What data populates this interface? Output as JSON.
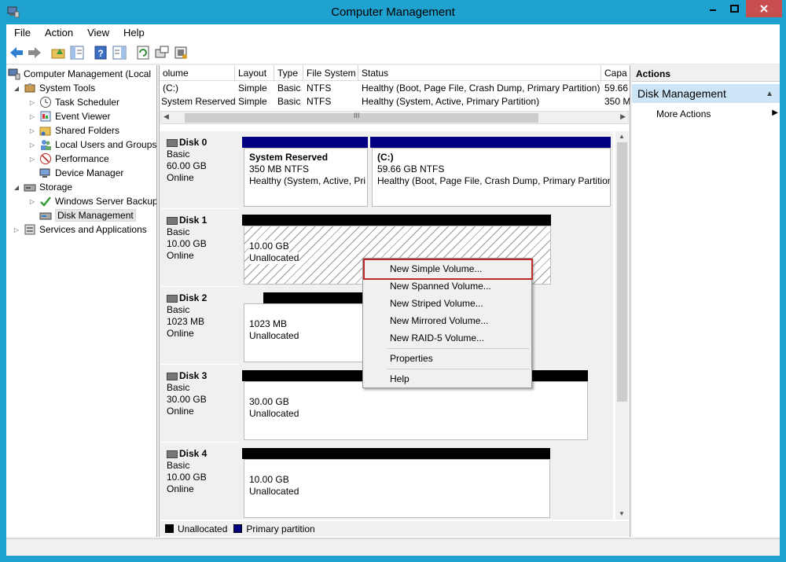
{
  "window": {
    "title": "Computer Management"
  },
  "menubar": [
    "File",
    "Action",
    "View",
    "Help"
  ],
  "toolbar": [
    "back-icon",
    "forward-icon",
    "up-folder-icon",
    "show-hide-tree-icon",
    "help-icon",
    "properties-pane-icon",
    "refresh-icon",
    "export-icon",
    "settings-icon"
  ],
  "tree": {
    "root": "Computer Management (Local",
    "system_tools": "System Tools",
    "task_scheduler": "Task Scheduler",
    "event_viewer": "Event Viewer",
    "shared_folders": "Shared Folders",
    "local_users": "Local Users and Groups",
    "performance": "Performance",
    "device_manager": "Device Manager",
    "storage": "Storage",
    "wsb": "Windows Server Backup",
    "disk_mgmt": "Disk Management",
    "services": "Services and Applications"
  },
  "volumes": {
    "headers": [
      "olume",
      "Layout",
      "Type",
      "File System",
      "Status",
      "Capa"
    ],
    "rows": [
      [
        "(C:)",
        "Simple",
        "Basic",
        "NTFS",
        "Healthy (Boot, Page File, Crash Dump, Primary Partition)",
        "59.66"
      ],
      [
        "System Reserved",
        "Simple",
        "Basic",
        "NTFS",
        "Healthy (System, Active, Primary Partition)",
        "350 M"
      ]
    ],
    "scroll_grip": "III"
  },
  "disks": [
    {
      "name": "Disk 0",
      "type": "Basic",
      "size": "60.00 GB",
      "state": "Online"
    },
    {
      "name": "Disk 1",
      "type": "Basic",
      "size": "10.00 GB",
      "state": "Online"
    },
    {
      "name": "Disk 2",
      "type": "Basic",
      "size": "1023 MB",
      "state": "Online"
    },
    {
      "name": "Disk 3",
      "type": "Basic",
      "size": "30.00 GB",
      "state": "Online"
    },
    {
      "name": "Disk 4",
      "type": "Basic",
      "size": "10.00 GB",
      "state": "Online"
    }
  ],
  "partitions": {
    "d0_sys": {
      "name": "System Reserved",
      "size": "350 MB NTFS",
      "status": "Healthy (System, Active, Pri"
    },
    "d0_c": {
      "name": "(C:)",
      "size": "59.66 GB NTFS",
      "status": "Healthy (Boot, Page File, Crash Dump, Primary Partition"
    },
    "d1": {
      "size": "10.00 GB",
      "status": "Unallocated"
    },
    "d2": {
      "size": "1023 MB",
      "status": "Unallocated"
    },
    "d3": {
      "size": "30.00 GB",
      "status": "Unallocated"
    },
    "d4": {
      "size": "10.00 GB",
      "status": "Unallocated"
    }
  },
  "legend": {
    "unallocated": "Unallocated",
    "primary": "Primary partition"
  },
  "actions": {
    "header": "Actions",
    "section": "Disk Management",
    "more": "More Actions"
  },
  "context_menu": {
    "items": [
      "New Simple Volume...",
      "New Spanned Volume...",
      "New Striped Volume...",
      "New Mirrored Volume...",
      "New RAID-5 Volume..."
    ],
    "properties": "Properties",
    "help": "Help"
  },
  "colors": {
    "primary_partition": "#000080",
    "unallocated": "#000000",
    "highlight_box": "#c0282d",
    "actions_section_bg": "#cde6f7"
  }
}
